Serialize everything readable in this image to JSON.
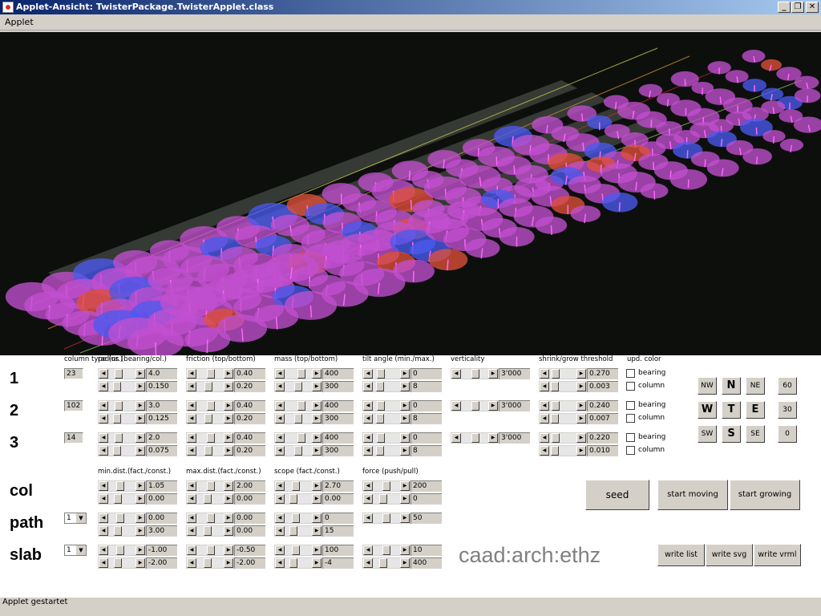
{
  "window": {
    "title": "Applet-Ansicht: TwisterPackage.TwisterApplet.class",
    "min": "_",
    "max": "❐",
    "close": "✕"
  },
  "menu": {
    "applet": "Applet"
  },
  "headers": {
    "column_type": "column type (nr.)",
    "radius": "radius (bearing/col.)",
    "friction": "friction (top/bottom)",
    "mass": "mass (top/bottom)",
    "tilt": "tilt angle (min./max.)",
    "verticality": "verticality",
    "shrink": "shrink/grow threshold",
    "upd_color": "upd. color",
    "min_dist": "min.dist.(fact./const.)",
    "max_dist": "max.dist.(fact./const.)",
    "scope": "scope (fact./const.)",
    "force": "force (push/pull)"
  },
  "rows": [
    {
      "label": "1",
      "type": "23",
      "radius": [
        "4.0",
        "0.150"
      ],
      "friction": [
        "0.40",
        "0.20"
      ],
      "mass": [
        "400",
        "300"
      ],
      "tilt": [
        "0",
        "8"
      ],
      "verticality": "3'000",
      "shrink": [
        "0.270",
        "0.003"
      ],
      "bearing": "bearing",
      "column": "column"
    },
    {
      "label": "2",
      "type": "102",
      "radius": [
        "3.0",
        "0.125"
      ],
      "friction": [
        "0.40",
        "0.20"
      ],
      "mass": [
        "400",
        "300"
      ],
      "tilt": [
        "0",
        "8"
      ],
      "verticality": "3'000",
      "shrink": [
        "0.240",
        "0.007"
      ],
      "bearing": "bearing",
      "column": "column"
    },
    {
      "label": "3",
      "type": "14",
      "radius": [
        "2.0",
        "0.075"
      ],
      "friction": [
        "0.40",
        "0.20"
      ],
      "mass": [
        "400",
        "300"
      ],
      "tilt": [
        "0",
        "8"
      ],
      "verticality": "3'000",
      "shrink": [
        "0.220",
        "0.010"
      ],
      "bearing": "bearing",
      "column": "column"
    }
  ],
  "params": [
    {
      "label": "col",
      "select": "",
      "min_dist": [
        "1.05",
        "0.00"
      ],
      "max_dist": [
        "2.00",
        "0.00"
      ],
      "scope": [
        "2.70",
        "0.00"
      ],
      "force": [
        "200",
        "0"
      ]
    },
    {
      "label": "path",
      "select": "1",
      "min_dist": [
        "0.00",
        "3.00"
      ],
      "max_dist": [
        "0.00",
        "0.00"
      ],
      "scope": [
        "0",
        "15"
      ],
      "force": [
        "50"
      ]
    },
    {
      "label": "slab",
      "select": "1",
      "min_dist": [
        "-1.00",
        "-2.00"
      ],
      "max_dist": [
        "-0.50",
        "-2.00"
      ],
      "scope": [
        "100",
        "-4"
      ],
      "force": [
        "10",
        "400"
      ]
    }
  ],
  "directions": {
    "nw": "NW",
    "n": "N",
    "ne": "NE",
    "w": "W",
    "t": "T",
    "e": "E",
    "sw": "SW",
    "s": "S",
    "se": "SE",
    "a60": "60",
    "a30": "30",
    "a0": "0"
  },
  "buttons": {
    "seed": "seed",
    "start_moving": "start moving",
    "start_growing": "start growing",
    "write_list": "write list",
    "write_svg": "write svg",
    "write_vrml": "write vrml"
  },
  "logo": "caad:arch:ethz",
  "status": "Applet gestartet",
  "colors": {
    "canvas_bg": "#0d0f0d",
    "disc_magenta": "#c14fd0",
    "disc_blue": "#4a5af0",
    "disc_red": "#e0503a"
  }
}
